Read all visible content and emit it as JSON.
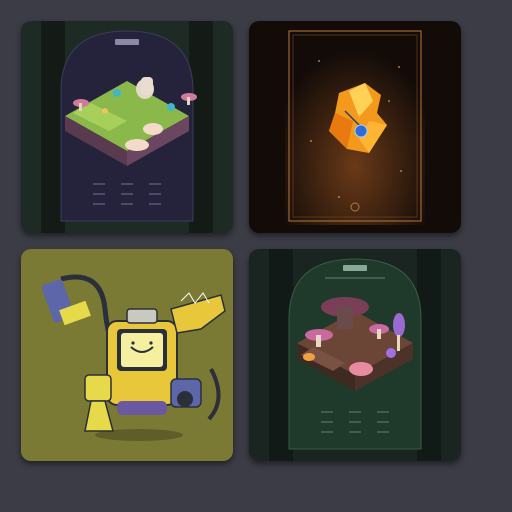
{
  "gallery": {
    "cards": [
      {
        "art": "floating-islands-isometric-map",
        "frame": "dark-arch"
      },
      {
        "art": "amber-crystal-with-blue-pendant",
        "frame": "gold-border-stars"
      },
      {
        "art": "yellow-robot-with-vacuum-arm",
        "frame": "olive-flat"
      },
      {
        "art": "mushroom-village-isometric-map",
        "frame": "dark-arch"
      }
    ]
  },
  "colors": {
    "page_background": "#3b3c45",
    "card1_panel": "#1e2a24",
    "card1_arch": "#23223a",
    "card2_background": "#120b08",
    "card2_gold": "#b9783a",
    "card3_background": "#7b7a35",
    "card4_panel": "#1a2420",
    "card4_arch": "#1e3a2b"
  }
}
